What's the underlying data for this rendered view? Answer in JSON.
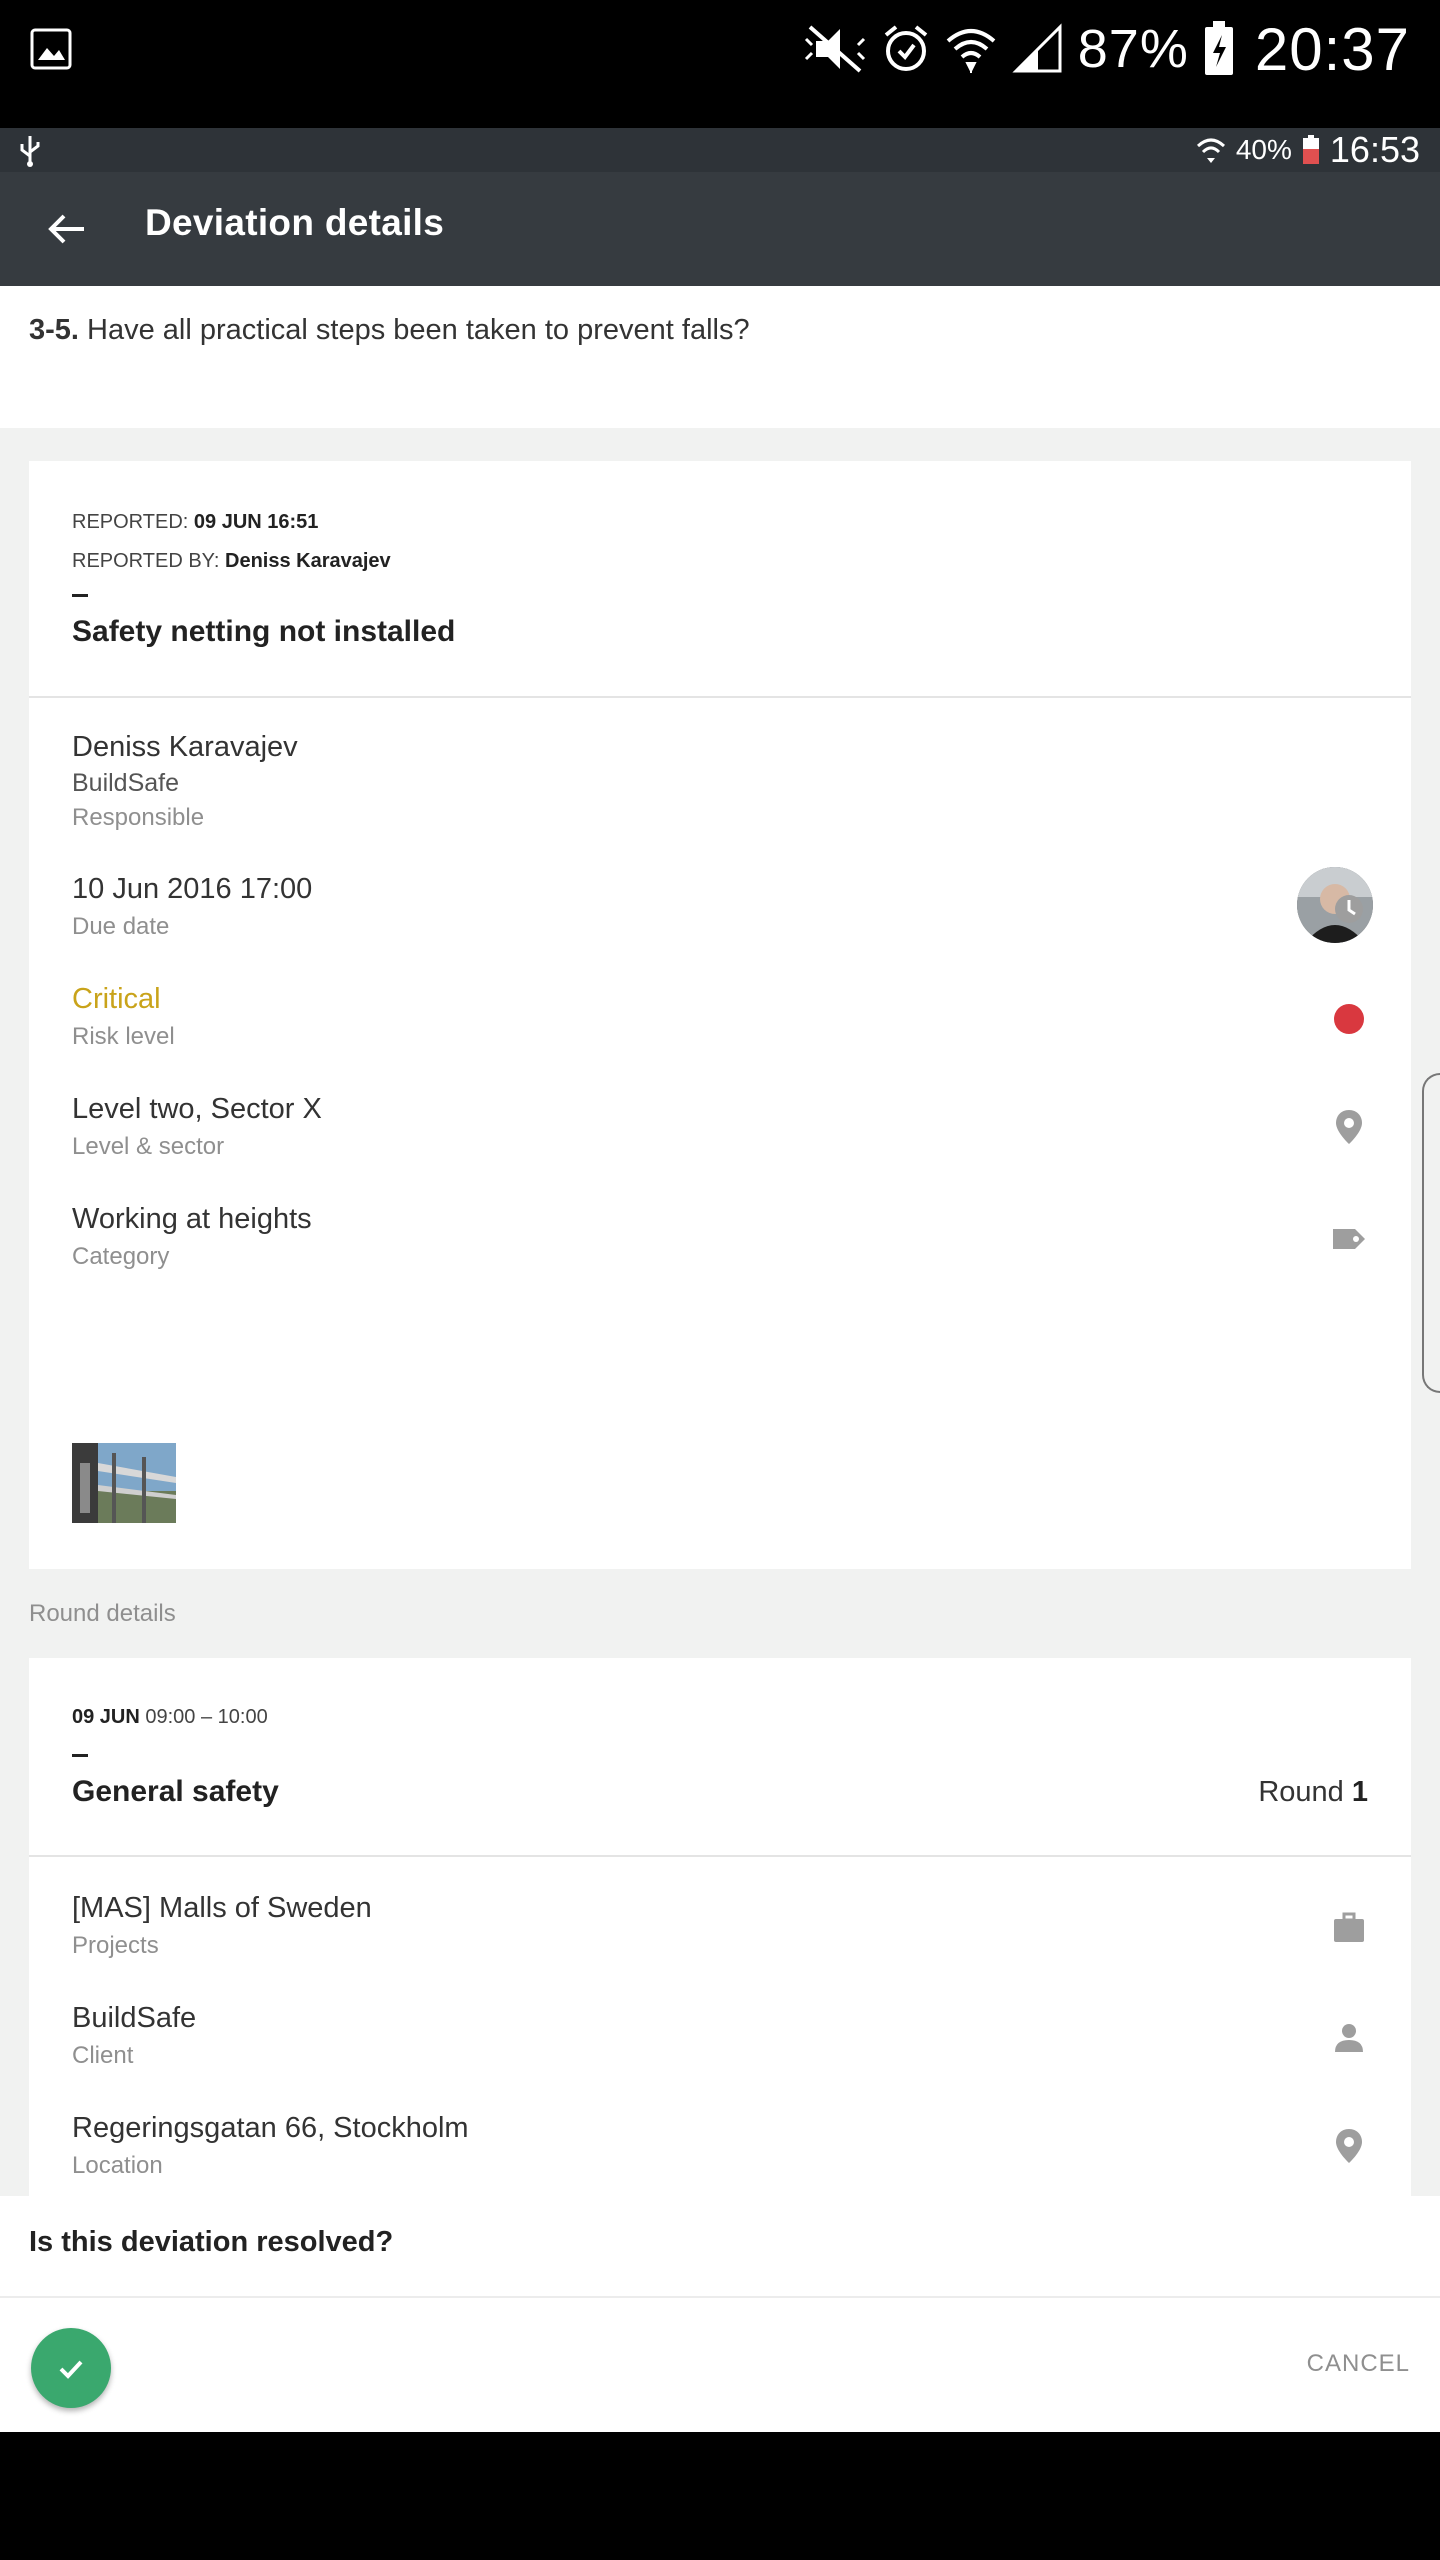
{
  "outer_status": {
    "battery": "87%",
    "time": "20:37"
  },
  "inner_status": {
    "battery": "40%",
    "time": "16:53"
  },
  "appbar": {
    "title": "Deviation details"
  },
  "question": {
    "number": "3-5.",
    "text": "Have all practical steps been taken to prevent falls?"
  },
  "deviation": {
    "reported_label": "REPORTED:",
    "reported_value": "09 JUN 16:51",
    "reported_by_label": "REPORTED BY:",
    "reported_by_value": "Deniss Karavajev",
    "title": "Safety netting not installed",
    "responsible_name": "Deniss Karavajev",
    "responsible_company": "BuildSafe",
    "responsible_label": "Responsible",
    "due_date": "10 Jun 2016 17:00",
    "due_date_label": "Due date",
    "risk_level": "Critical",
    "risk_level_label": "Risk level",
    "risk_color": "#d9383f",
    "level_sector": "Level two, Sector X",
    "level_sector_label": "Level & sector",
    "category": "Working at heights",
    "category_label": "Category"
  },
  "round_section_label": "Round details",
  "round": {
    "date": "09 JUN",
    "time_range": "09:00 – 10:00",
    "title": "General safety",
    "round_label": "Round",
    "round_number": "1",
    "project_code": "[MAS]",
    "project_name": "Malls of Sweden",
    "project_label": "Projects",
    "client": "BuildSafe",
    "client_label": "Client",
    "location": "Regeringsgatan 66, Stockholm",
    "location_label": "Location"
  },
  "resolve": {
    "question": "Is this deviation resolved?",
    "cancel_label": "CANCEL",
    "confirm_color": "#3aa86e"
  },
  "icons": [
    "gallery-icon",
    "mute-icon",
    "alarm-icon",
    "wifi-icon",
    "signal-icon",
    "battery-icon",
    "usb-icon",
    "back-arrow-icon",
    "clock-icon",
    "risk-dot-icon",
    "location-pin-icon",
    "tag-icon",
    "briefcase-icon",
    "person-icon",
    "check-icon"
  ]
}
